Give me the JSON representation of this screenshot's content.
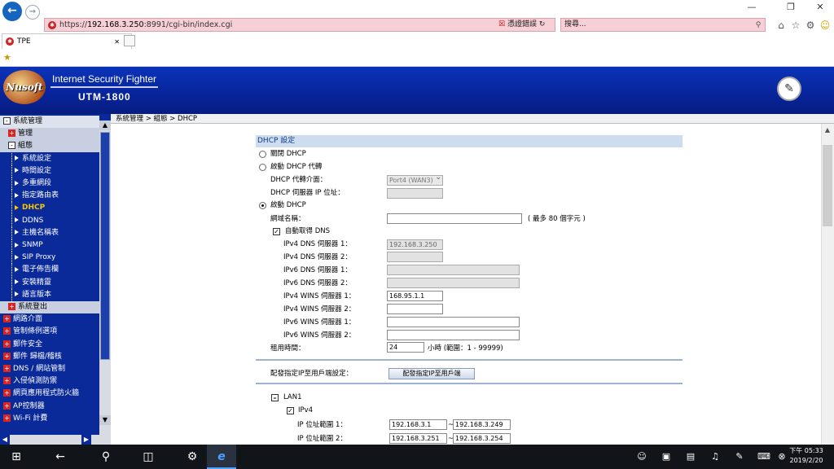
{
  "browser": {
    "url_prefix": "https://",
    "url_host": "192.168.3.250",
    "url_rest": ":8991/cgi-bin/index.cgi",
    "cert_error": "憑證錯誤",
    "search_placeholder": "搜尋...",
    "tab_title": "TPE",
    "colors": {
      "address_bg": "#f7cfd6",
      "back_button": "#1565c0"
    }
  },
  "header": {
    "logo_text": "Nusoft",
    "brand_line1": "Internet Security Fighter",
    "brand_line2": "UTM-1800"
  },
  "breadcrumb": "系統管理 > 組態 > DHCP",
  "sidebar": {
    "items": [
      {
        "label": "系統管理",
        "kind": "section-open"
      },
      {
        "label": "管理",
        "kind": "group-collapsed"
      },
      {
        "label": "組態",
        "kind": "group-open"
      },
      {
        "label": "系統設定",
        "kind": "leaf"
      },
      {
        "label": "時間設定",
        "kind": "leaf"
      },
      {
        "label": "多重網段",
        "kind": "leaf"
      },
      {
        "label": "指定路由表",
        "kind": "leaf"
      },
      {
        "label": "DHCP",
        "kind": "leaf-active"
      },
      {
        "label": "DDNS",
        "kind": "leaf"
      },
      {
        "label": "主機名稱表",
        "kind": "leaf"
      },
      {
        "label": "SNMP",
        "kind": "leaf"
      },
      {
        "label": "SIP Proxy",
        "kind": "leaf"
      },
      {
        "label": "電子佈告欄",
        "kind": "leaf"
      },
      {
        "label": "安裝精靈",
        "kind": "leaf"
      },
      {
        "label": "語言版本",
        "kind": "leaf"
      },
      {
        "label": "系統登出",
        "kind": "group-collapsed"
      },
      {
        "label": "網路介面",
        "kind": "section"
      },
      {
        "label": "管制條例選項",
        "kind": "section"
      },
      {
        "label": "郵件安全",
        "kind": "section"
      },
      {
        "label": "郵件 歸檔/稽核",
        "kind": "section"
      },
      {
        "label": "DNS / 網站管制",
        "kind": "section"
      },
      {
        "label": "入侵偵測防禦",
        "kind": "section"
      },
      {
        "label": "網頁應用程式防火牆",
        "kind": "section"
      },
      {
        "label": "AP控制器",
        "kind": "section"
      },
      {
        "label": "Wi-Fi 計費",
        "kind": "section"
      }
    ]
  },
  "form": {
    "section_title": "DHCP 設定",
    "opt_disable": "關閉 DHCP",
    "opt_relay": "啟動 DHCP 代轉",
    "relay_iface_label": "DHCP 代轉介面：",
    "relay_iface_value": "Port4 (WAN3)",
    "relay_server_label": "DHCP 伺服器 IP 位址：",
    "opt_enable": "啟動 DHCP",
    "domain_label": "網域名稱：",
    "domain_hint": "( 最多 80 個字元 )",
    "auto_dns_label": "自動取得 DNS",
    "ipv4_dns1_label": "IPv4 DNS 伺服器 1：",
    "ipv4_dns1_value": "192.168.3.250",
    "ipv4_dns2_label": "IPv4 DNS 伺服器 2：",
    "ipv6_dns1_label": "IPv6 DNS 伺服器 1：",
    "ipv6_dns2_label": "IPv6 DNS 伺服器 2：",
    "ipv4_wins1_label": "IPv4 WINS 伺服器 1：",
    "ipv4_wins1_value": "168.95.1.1",
    "ipv4_wins2_label": "IPv4 WINS 伺服器 2：",
    "ipv6_wins1_label": "IPv6 WINS 伺服器 1：",
    "ipv6_wins2_label": "IPv6 WINS 伺服器 2：",
    "lease_label": "租用時間：",
    "lease_value": "24",
    "lease_hint": "小時 (範圍：1 - 99999)",
    "assign_label": "配發指定IP至用戶端設定：",
    "assign_button": "配發指定IP至用戶端",
    "lan_label": "LAN1",
    "ipv4_label": "IPv4",
    "range1_label": "IP 位址範圍 1：",
    "range1_start": "192.168.3.1",
    "range1_end": "192.168.3.249",
    "range2_label": "IP 位址範圍 2：",
    "range2_start": "192.168.3.251",
    "range2_end": "192.168.3.254",
    "range_sep": "~"
  },
  "taskbar": {
    "time": "下午 05:33",
    "date": "2019/2/20"
  }
}
